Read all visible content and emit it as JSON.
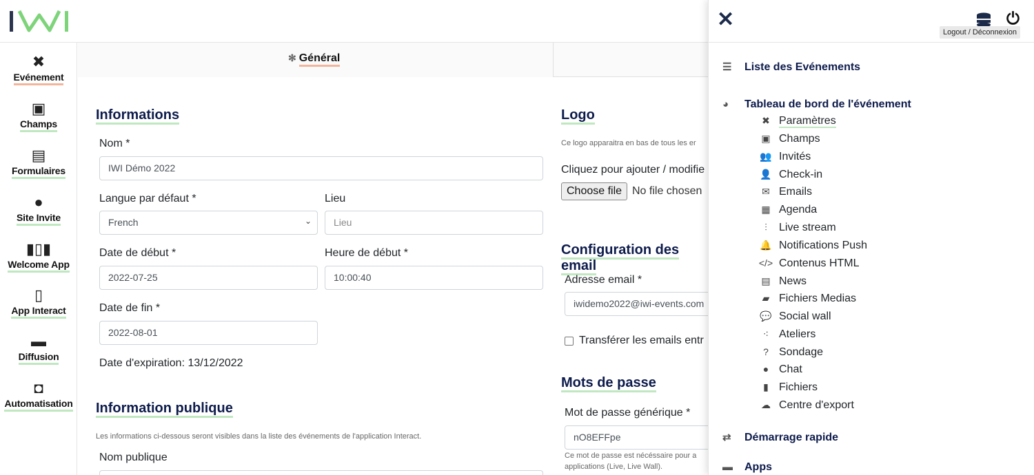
{
  "sidebar": {
    "items": [
      {
        "label": "Evénement",
        "icon": "tools-icon"
      },
      {
        "label": "Champs",
        "icon": "list-icon"
      },
      {
        "label": "Formulaires",
        "icon": "form-icon"
      },
      {
        "label": "Site Invite",
        "icon": "globe-icon"
      },
      {
        "label": "Welcome App",
        "icon": "barcode-icon"
      },
      {
        "label": "App Interact",
        "icon": "phone-icon"
      },
      {
        "label": "Diffusion",
        "icon": "monitor-icon"
      },
      {
        "label": "Automatisation",
        "icon": "robot-icon"
      }
    ]
  },
  "tabs": {
    "general": "Général"
  },
  "form": {
    "informations_title": "Informations",
    "nom_label": "Nom *",
    "nom_value": "IWI Démo 2022",
    "langue_label": "Langue par défaut *",
    "langue_value": "French",
    "lieu_label": "Lieu",
    "lieu_placeholder": "Lieu",
    "date_debut_label": "Date de début *",
    "date_debut_value": "2022-07-25",
    "heure_debut_label": "Heure de début *",
    "heure_debut_value": "10:00:40",
    "date_fin_label": "Date de fin *",
    "date_fin_value": "2022-08-01",
    "expiration_text": "Date d'expiration: 13/12/2022",
    "info_publique_title": "Information publique",
    "info_publique_note": "Les informations ci-dessous seront visibles dans la liste des événements de l'application Interact.",
    "nom_publique_label": "Nom publique"
  },
  "logo_section": {
    "title": "Logo",
    "note": "Ce logo apparaitra en bas de tous les er",
    "click_text": "Cliquez pour ajouter / modifie",
    "file_button": "Choose file",
    "no_file": "No file chosen"
  },
  "email_section": {
    "title": "Configuration des email",
    "address_label": "Adresse email *",
    "address_value": "iwidemo2022@iwi-events.com",
    "transfer_label": "Transférer les emails entr"
  },
  "password_section": {
    "title": "Mots de passe",
    "generic_label": "Mot de passe générique *",
    "generic_value": "nO8EFFpe",
    "note_line1": "Ce mot de passe est nécéssaire pour a",
    "note_line2": "applications (Live, Live Wall)."
  },
  "drawer": {
    "tooltip": "Logout / Déconnexion",
    "events_list": "Liste des Evénements",
    "dashboard": "Tableau de bord de l'événement",
    "items": [
      {
        "label": "Paramètres",
        "icon": "tools-icon"
      },
      {
        "label": "Champs",
        "icon": "list-icon"
      },
      {
        "label": "Invités",
        "icon": "users-icon"
      },
      {
        "label": "Check-in",
        "icon": "user-check-icon"
      },
      {
        "label": "Emails",
        "icon": "envelope-icon"
      },
      {
        "label": "Agenda",
        "icon": "calendar-icon"
      },
      {
        "label": "Live stream",
        "icon": "waveform-icon"
      },
      {
        "label": "Notifications Push",
        "icon": "bell-icon"
      },
      {
        "label": "Contenus HTML",
        "icon": "code-icon"
      },
      {
        "label": "News",
        "icon": "newspaper-icon"
      },
      {
        "label": "Fichiers Medias",
        "icon": "folder-icon"
      },
      {
        "label": "Social wall",
        "icon": "comments-icon"
      },
      {
        "label": "Ateliers",
        "icon": "share-icon"
      },
      {
        "label": "Sondage",
        "icon": "question-icon"
      },
      {
        "label": "Chat",
        "icon": "chat-icon"
      },
      {
        "label": "Fichiers",
        "icon": "file-icon"
      },
      {
        "label": "Centre d'export",
        "icon": "cloud-download-icon"
      }
    ],
    "quick_start": "Démarrage rapide",
    "apps": "Apps"
  },
  "colors": {
    "accent_green": "#bfe7c0",
    "accent_orange": "#f2b49a",
    "title_navy": "#0d1b4b"
  }
}
